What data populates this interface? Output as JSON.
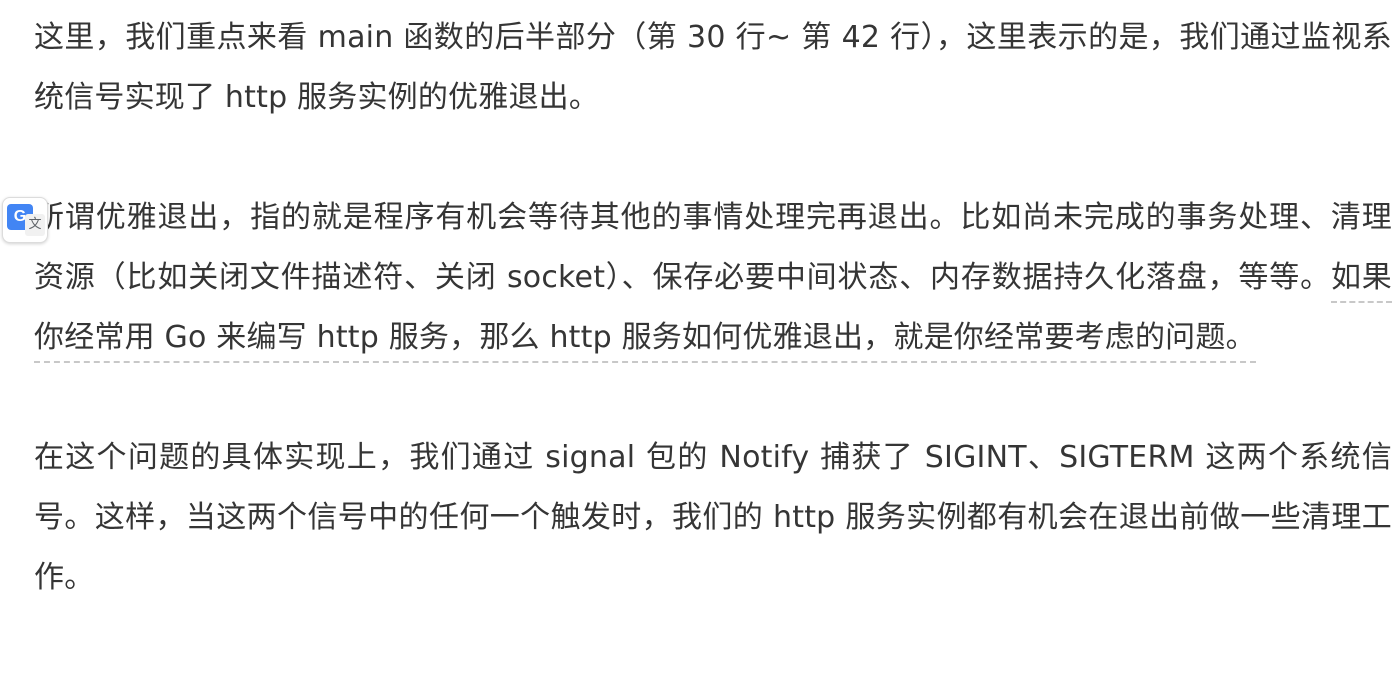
{
  "article": {
    "paragraphs": [
      {
        "text": "这里，我们重点来看 main 函数的后半部分（第 30 行~ 第 42 行），这里表示的是，我们通过监视系统信号实现了 http 服务实例的优雅退出。"
      },
      {
        "text": "所谓优雅退出，指的就是程序有机会等待其他的事情处理完再退出。比如尚未完成的事务处理、清理资源（比如关闭文件描述符、关闭 socket）、保存必要中间状态、内存数据持久化落盘，等等。",
        "highlight": "如果你经常用 Go 来编写 http 服务，那么 http 服务如何优雅退出，就是你经常要考虑的问题。"
      },
      {
        "text": "在这个问题的具体实现上，我们通过 signal 包的 Notify 捕获了 SIGINT、SIGTERM 这两个系统信号。这样，当这两个信号中的任何一个触发时，我们的 http 服务实例都有机会在退出前做一些清理工作。"
      }
    ]
  },
  "translate_widget": {
    "icon": "google-translate-icon",
    "g_glyph": "G",
    "wen_glyph": "文",
    "brand_color": "#4285f4"
  },
  "colors": {
    "text": "#353535",
    "highlight_underline": "#c8c8c8"
  }
}
